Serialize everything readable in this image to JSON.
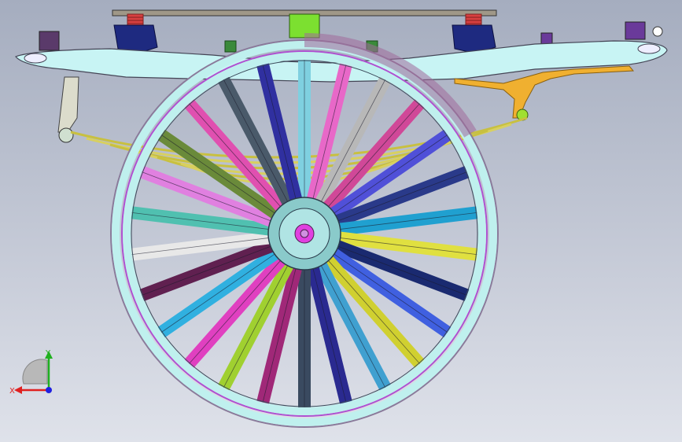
{
  "viewport": {
    "background_top": "#a5adbf",
    "background_bottom": "#dfe2ea"
  },
  "triad": {
    "x_label": "X",
    "y_label": "Y",
    "x_color": "#e02020",
    "y_color": "#20b020",
    "z_color": "#2020e0"
  },
  "model": {
    "spoke_colors": [
      "#7fd0e0",
      "#e868c8",
      "#b8b8b8",
      "#d04898",
      "#5050d8",
      "#2a3a8a",
      "#20a0d0",
      "#e0e040",
      "#1a2a70",
      "#4060e0",
      "#d0d030",
      "#40a0d0",
      "#2a2a90",
      "#3a4a60",
      "#a02878",
      "#a0d030",
      "#e040c0",
      "#30b0e0",
      "#602050",
      "#e8e8e8",
      "#50c0b0",
      "#e080e0",
      "#6a8a3a",
      "#e050b0",
      "#4a5a6a",
      "#3030a0"
    ],
    "rim_color": "#bff0ee",
    "spring_color": "#d8d860",
    "frame_color": "#c8f4f4",
    "hub_color": "#8acaca",
    "hub_center_color": "#e040e0"
  }
}
